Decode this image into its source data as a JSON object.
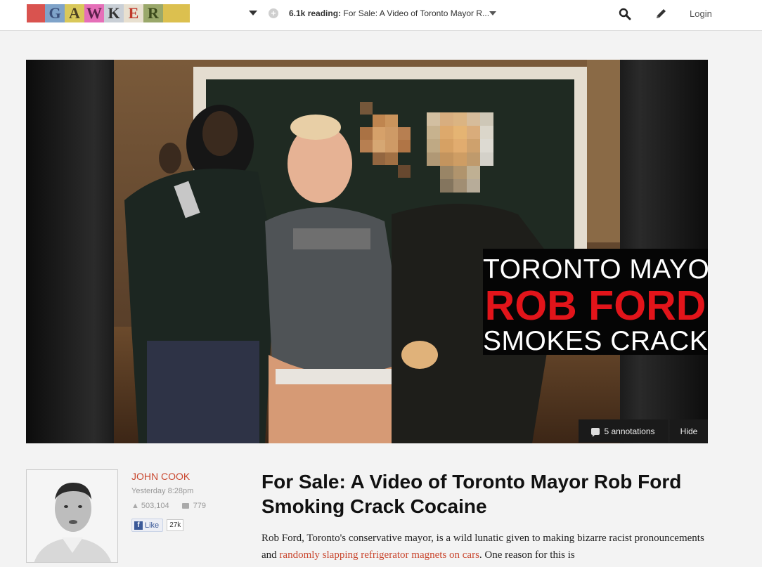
{
  "logo": {
    "letters": [
      "G",
      "A",
      "W",
      "K",
      "E",
      "R"
    ]
  },
  "topbar": {
    "reading_count": "6.1k reading:",
    "reading_title": "For Sale: A Video of Toronto Mayor R...",
    "login_label": "Login"
  },
  "hero": {
    "overlay_line1": "TORONTO MAYOR",
    "overlay_line2": "ROB FORD",
    "overlay_line3": "SMOKES CRACK",
    "annotations_label": "5 annotations",
    "hide_label": "Hide"
  },
  "author": {
    "name": "JOHN COOK",
    "time": "Yesterday 8:28pm",
    "views": "503,104",
    "comments": "779",
    "like_label": "Like",
    "like_count": "27k"
  },
  "article": {
    "headline": "For Sale: A Video of Toronto Mayor Rob Ford Smoking Crack Cocaine",
    "body_part1": "Rob Ford, Toronto's conservative mayor, is a wild lunatic given to making bizarre racist pronouncements and ",
    "body_link": "randomly slapping refrigerator magnets on cars",
    "body_part2": ". One reason for this is"
  },
  "colors": {
    "accent": "#c9472f",
    "overlay_red": "#e2141a",
    "facebook_blue": "#3b5998"
  }
}
